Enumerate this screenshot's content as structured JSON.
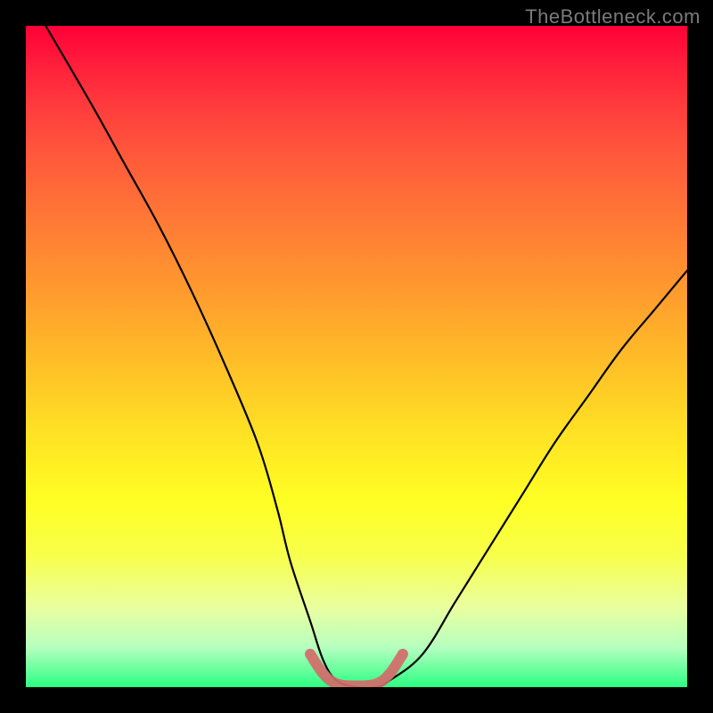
{
  "watermark": "TheBottleneck.com",
  "colors": {
    "frame": "#000000",
    "curve": "#000000",
    "overlay_stroke": "#d46a6a",
    "gradient_stops": [
      "#ff0037",
      "#ff1f3b",
      "#ff3b3d",
      "#ff5a3b",
      "#ff7b35",
      "#ff9a2e",
      "#ffc227",
      "#ffe324",
      "#ffff24",
      "#f8ff4a",
      "#e9ffa0",
      "#b6ffbf",
      "#2bff83"
    ]
  },
  "chart_data": {
    "type": "line",
    "title": "",
    "xlabel": "",
    "ylabel": "",
    "x_range": [
      0,
      100
    ],
    "y_range": [
      0,
      100
    ],
    "series": [
      {
        "name": "bottleneck-curve",
        "x": [
          3,
          10,
          15,
          20,
          25,
          30,
          35,
          38,
          40,
          43,
          45,
          47,
          50,
          53,
          55,
          60,
          65,
          70,
          75,
          80,
          85,
          90,
          95,
          100
        ],
        "values": [
          100,
          88,
          79,
          70,
          60,
          49,
          37,
          27,
          19,
          10,
          4,
          1,
          0,
          0,
          1,
          5,
          13,
          21,
          29,
          37,
          44,
          51,
          57,
          63
        ]
      }
    ],
    "overlay": {
      "name": "highlight-band",
      "x": [
        43,
        45,
        47,
        50,
        53,
        55,
        57
      ],
      "values": [
        5,
        2,
        0.5,
        0.2,
        0.5,
        2,
        5
      ]
    }
  }
}
